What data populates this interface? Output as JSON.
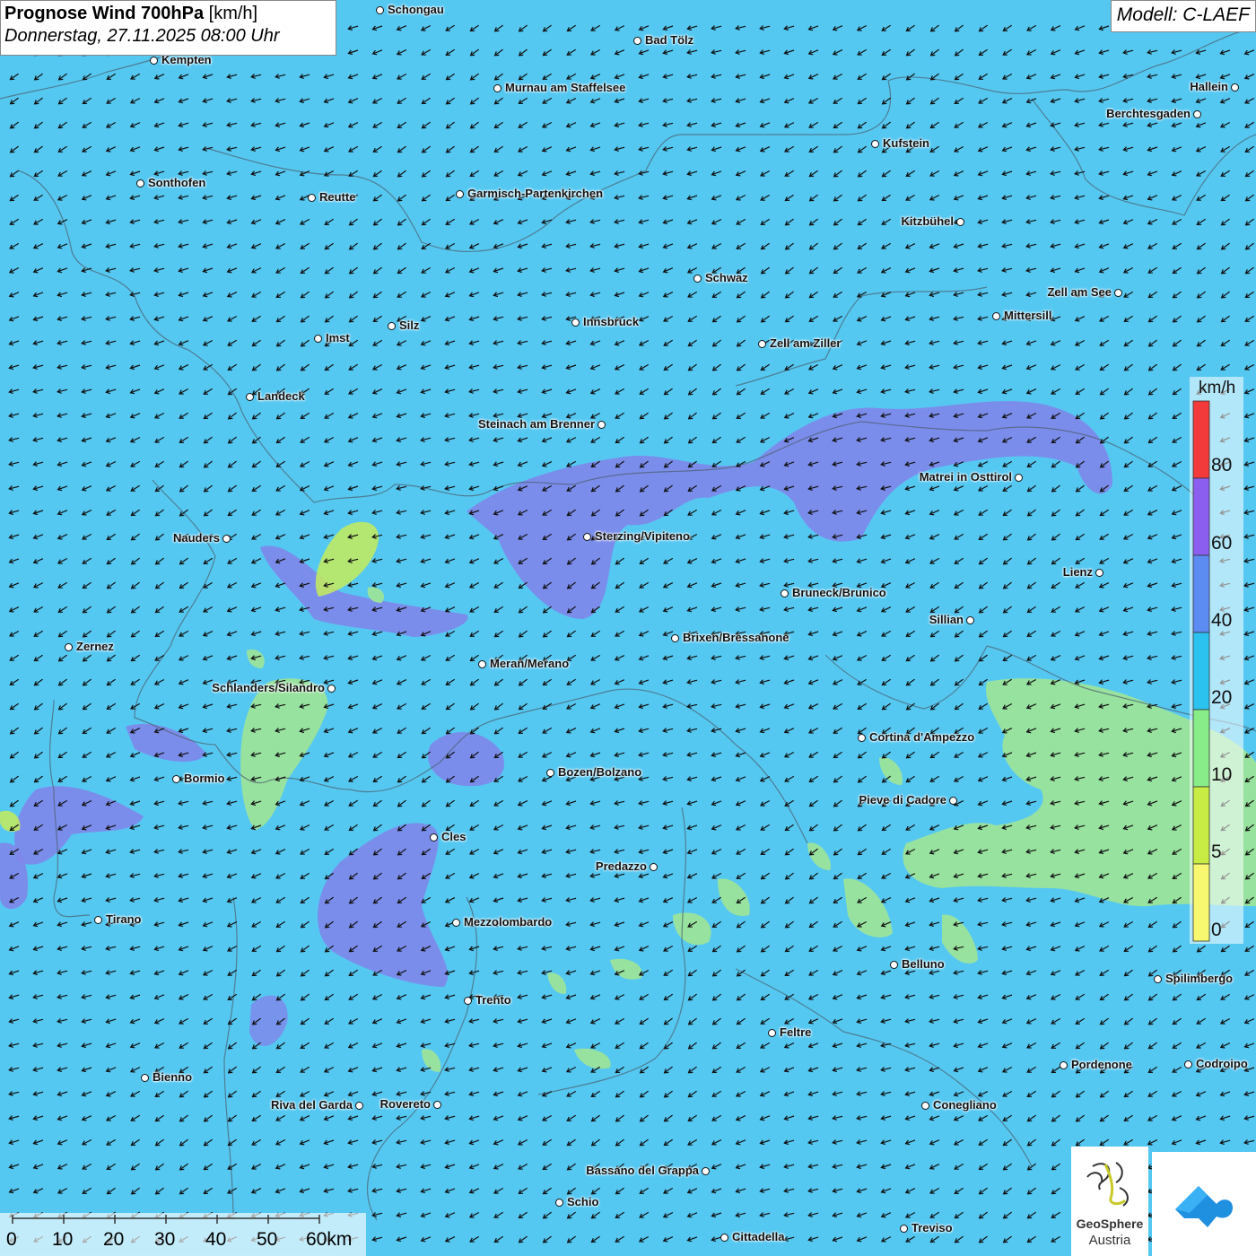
{
  "title": {
    "bold": "Prognose Wind 700hPa",
    "unit": "[km/h]",
    "date": "Donnerstag, 27.11.2025 08:00 Uhr"
  },
  "model": "Modell: C-LAEF",
  "legend": {
    "unit": "km/h",
    "labels": [
      "80",
      "60",
      "40",
      "20",
      "10",
      "5",
      "0"
    ],
    "colors": [
      "#f23a3a",
      "#8c5ef0",
      "#5c8cf2",
      "#2cc2ef",
      "#88ec88",
      "#c8ec44",
      "#f8f870"
    ]
  },
  "scale": {
    "labels": [
      "0",
      "10",
      "20",
      "30",
      "40",
      "50",
      "60km"
    ]
  },
  "logo": {
    "name": "GeoSphere",
    "sub": "Austria"
  },
  "wind": {
    "direction": "from north-east",
    "typical_speed": "20-40 km/h"
  },
  "cities": [
    {
      "name": "Schongau"
    },
    {
      "name": "Bad Tölz"
    },
    {
      "name": "Kempten"
    },
    {
      "name": "Murnau am Staffelsee"
    },
    {
      "name": "Hallein"
    },
    {
      "name": "Berchtesgaden"
    },
    {
      "name": "Kufstein"
    },
    {
      "name": "Sonthofen"
    },
    {
      "name": "Reutte"
    },
    {
      "name": "Garmisch-Partenkirchen"
    },
    {
      "name": "Kitzbühel"
    },
    {
      "name": "Schwaz"
    },
    {
      "name": "Zell am See"
    },
    {
      "name": "Mittersill"
    },
    {
      "name": "Innsbruck"
    },
    {
      "name": "Silz"
    },
    {
      "name": "Imst"
    },
    {
      "name": "Zell am Ziller"
    },
    {
      "name": "Landeck"
    },
    {
      "name": "Steinach am Brenner"
    },
    {
      "name": "Matrei in Osttirol"
    },
    {
      "name": "Nauders"
    },
    {
      "name": "Sterzing/Vipiteno"
    },
    {
      "name": "Lienz"
    },
    {
      "name": "Bruneck/Brunico"
    },
    {
      "name": "Sillian"
    },
    {
      "name": "Zernez"
    },
    {
      "name": "Brixen/Bressanone"
    },
    {
      "name": "Meran/Merano"
    },
    {
      "name": "Schlanders/Silandro"
    },
    {
      "name": "Cortina d'Ampezzo"
    },
    {
      "name": "Bozen/Bolzano"
    },
    {
      "name": "Bormio"
    },
    {
      "name": "Pieve di Cadore"
    },
    {
      "name": "Cles"
    },
    {
      "name": "Predazzo"
    },
    {
      "name": "Tirano"
    },
    {
      "name": "Mezzolombardo"
    },
    {
      "name": "Belluno"
    },
    {
      "name": "Spilimbergo"
    },
    {
      "name": "Trento"
    },
    {
      "name": "Feltre"
    },
    {
      "name": "Pordenone"
    },
    {
      "name": "Codroipo"
    },
    {
      "name": "Bienno"
    },
    {
      "name": "Riva del Garda"
    },
    {
      "name": "Rovereto"
    },
    {
      "name": "Conegliano"
    },
    {
      "name": "Bassano del Grappa"
    },
    {
      "name": "Schio"
    },
    {
      "name": "Treviso"
    },
    {
      "name": "Cittadella"
    }
  ]
}
